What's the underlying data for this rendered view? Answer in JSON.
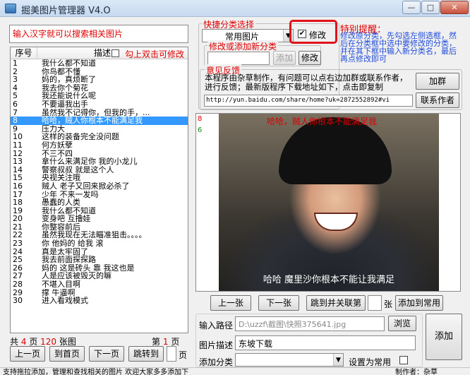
{
  "window": {
    "title": "掘美图片管理器 V4.O",
    "min": "—",
    "max": "□",
    "close": "✕"
  },
  "search": {
    "placeholder": "输入汉字就可以搜索相关图片"
  },
  "list": {
    "col_no": "序号",
    "col_desc": "描述",
    "hint": "勾上双击可修改",
    "rows": [
      {
        "n": "1",
        "t": "我什么都不知道"
      },
      {
        "n": "2",
        "t": "你鸟都不懂"
      },
      {
        "n": "3",
        "t": "妈的，真烦断了"
      },
      {
        "n": "4",
        "t": "我去你个菊花"
      },
      {
        "n": "5",
        "t": "我还能说什么呢"
      },
      {
        "n": "6",
        "t": "不要逼我出手"
      },
      {
        "n": "7",
        "t": "虽然我不记得你，但我的手，..."
      },
      {
        "n": "8",
        "t": "哈哈，贼人你根本不能满足我"
      },
      {
        "n": "9",
        "t": "压力大"
      },
      {
        "n": "10",
        "t": "这样的装备完全没问题"
      },
      {
        "n": "11",
        "t": "何方妖孽"
      },
      {
        "n": "12",
        "t": "不三不四"
      },
      {
        "n": "13",
        "t": "拿什么来满足你 我的小龙儿"
      },
      {
        "n": "14",
        "t": "警察叔叔 就是这个人"
      },
      {
        "n": "15",
        "t": "央视关注哦"
      },
      {
        "n": "16",
        "t": "贼人 老子又回来掀必杀了"
      },
      {
        "n": "17",
        "t": "少年 不来一发吗"
      },
      {
        "n": "18",
        "t": "愚蠢的人类"
      },
      {
        "n": "19",
        "t": "我什么都不知道"
      },
      {
        "n": "20",
        "t": "变身吧 互撸娃"
      },
      {
        "n": "21",
        "t": "你整容前后"
      },
      {
        "n": "22",
        "t": "虽然我现在无法瞄准狙击。。。。"
      },
      {
        "n": "23",
        "t": "你 他妈的 给我 滚"
      },
      {
        "n": "24",
        "t": "真是太牢固了"
      },
      {
        "n": "25",
        "t": "我去前面探探路"
      },
      {
        "n": "26",
        "t": "妈的 这是砖头 靠 我这也是"
      },
      {
        "n": "27",
        "t": "人是应该被毁灭的嘛"
      },
      {
        "n": "28",
        "t": "不堪入目啊"
      },
      {
        "n": "29",
        "t": "撑 牛逼啊"
      },
      {
        "n": "30",
        "t": "进入看戏模式"
      }
    ],
    "selected_index": 7
  },
  "paging": {
    "total_prefix": "共",
    "pages": "4",
    "page_unit": "页",
    "count": "120",
    "count_unit": "张图",
    "current_prefix": "第",
    "current": "1",
    "current_unit": "页",
    "prev": "上一页",
    "first": "到首页",
    "next": "下一页",
    "jump": "跳转到",
    "jump_unit": "页"
  },
  "quick_category": {
    "title": "快捷分类选择",
    "selected": "常用图片",
    "edit_checkbox": "修改",
    "edit_checked": "✔",
    "edit_group_title": "修改或添加新分类",
    "add_btn": "添加",
    "modify_btn": "修改"
  },
  "tip": {
    "title": "特别提醒：",
    "body": "修改原分类，先勾选左侧选框，然后在分类框中选中要修改的分类，并在其下框中输入新分类名，最后再点修改即可"
  },
  "feedback": {
    "title": "意见反馈",
    "text": "本程序由杂草制作，有问题可以点右边加群或联系作者，进行反馈；最新版程序下载地址如下，点击即复制",
    "url": "http://yun.baidu.com/share/home?uk=2872552892#vi",
    "join_btn": "加群",
    "contact_btn": "联系作者"
  },
  "preview": {
    "overlay": "哈哈，贼人你根本不能满足我",
    "subtitle": "哈哈  魔里沙你根本不能让我满足",
    "side_top": "8",
    "side_mid": "6"
  },
  "nav": {
    "prev": "上一张",
    "next": "下一张",
    "jump": "跳到并关联第",
    "jump_unit": "张",
    "add_common": "添加到常用"
  },
  "form": {
    "path_label": "输入路径",
    "path_value": "D:\\uzzf\\截图\\快照375641.jpg",
    "browse_btn": "浏览",
    "desc_label": "图片描述",
    "desc_value": "东坡下载",
    "category_label": "添加分类",
    "set_common": "设置为常用",
    "add_btn": "添加"
  },
  "status": {
    "left": "支持拖拉添加，管理和查找相关的图片 欢迎大家多多添加下",
    "right": "制作者：杂草"
  }
}
